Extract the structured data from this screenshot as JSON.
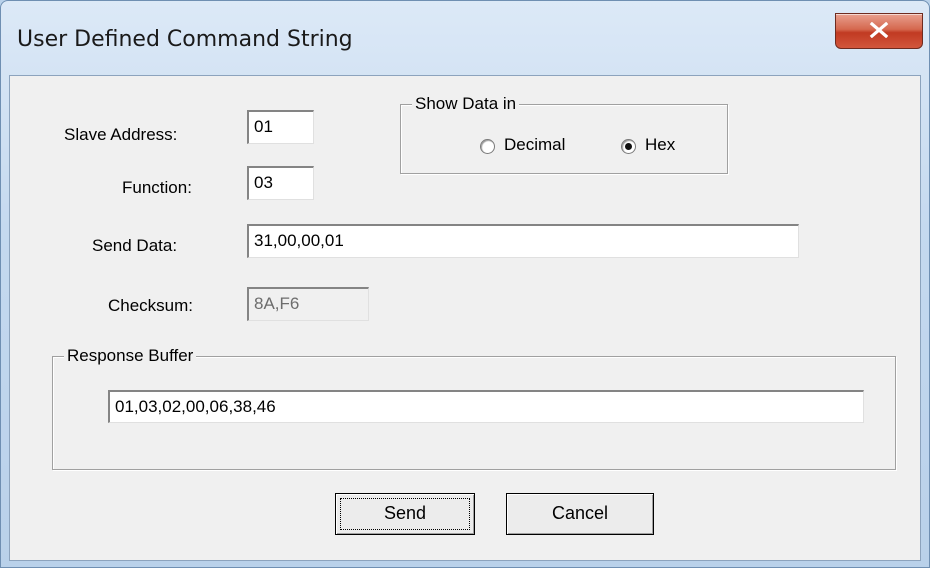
{
  "dialog": {
    "title": "User Defined Command String",
    "close_icon": "close-icon",
    "close_color": "#c13a22"
  },
  "fields": {
    "slave_address": {
      "label": "Slave Address:",
      "value": "01"
    },
    "function": {
      "label": "Function:",
      "value": "03"
    },
    "send_data": {
      "label": "Send Data:",
      "value": "31,00,00,01"
    },
    "checksum": {
      "label": "Checksum:",
      "value": "8A,F6",
      "enabled": false
    }
  },
  "show_data": {
    "title": "Show Data in",
    "options": [
      {
        "label": "Decimal",
        "selected": false
      },
      {
        "label": "Hex",
        "selected": true
      }
    ]
  },
  "response_buffer": {
    "title": "Response Buffer",
    "value": "01,03,02,00,06,38,46"
  },
  "buttons": {
    "send": "Send",
    "cancel": "Cancel"
  }
}
